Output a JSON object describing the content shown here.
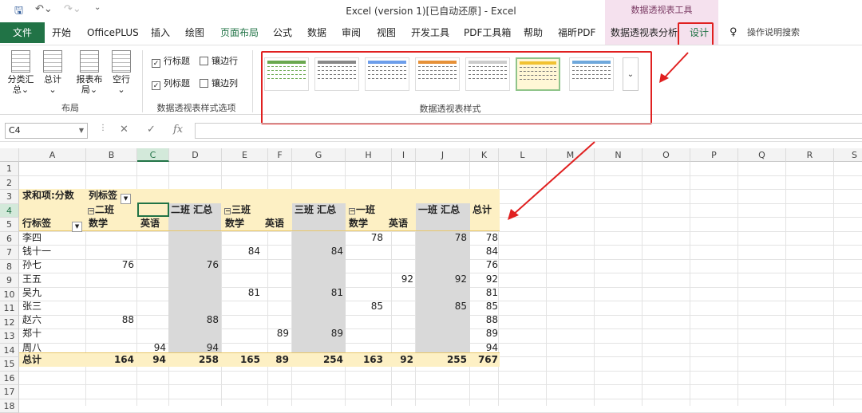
{
  "titlebar": {
    "title": "Excel (version 1)[已自动还原]  -  Excel",
    "context_tools": "数据透视表工具"
  },
  "tabs": [
    {
      "label": "文件"
    },
    {
      "label": "开始"
    },
    {
      "label": "OfficePLUS"
    },
    {
      "label": "插入"
    },
    {
      "label": "绘图"
    },
    {
      "label": "页面布局"
    },
    {
      "label": "公式"
    },
    {
      "label": "数据"
    },
    {
      "label": "审阅"
    },
    {
      "label": "视图"
    },
    {
      "label": "开发工具"
    },
    {
      "label": "PDF工具箱"
    },
    {
      "label": "帮助"
    },
    {
      "label": "福昕PDF"
    },
    {
      "label": "数据透视表分析"
    },
    {
      "label": "设计"
    },
    {
      "label": "操作说明搜索"
    }
  ],
  "ribbon": {
    "layout_buttons": [
      {
        "label1": "分类汇",
        "label2": "总⌄"
      },
      {
        "label1": "总计",
        "label2": "⌄"
      },
      {
        "label1": "报表布",
        "label2": "局⌄"
      },
      {
        "label1": "空行",
        "label2": "⌄"
      }
    ],
    "layout_group": "布局",
    "options": [
      {
        "label": "行标题",
        "checked": true
      },
      {
        "label": "镶边行",
        "checked": false
      },
      {
        "label": "列标题",
        "checked": true
      },
      {
        "label": "镶边列",
        "checked": false
      }
    ],
    "options_group": "数据透视表样式选项",
    "styles_group": "数据透视表样式"
  },
  "formula_bar": {
    "name_box": "C4",
    "fx": "fx"
  },
  "columns": [
    "A",
    "B",
    "C",
    "D",
    "E",
    "F",
    "G",
    "H",
    "I",
    "J",
    "K",
    "L",
    "M",
    "N",
    "O",
    "P",
    "Q",
    "R",
    "S"
  ],
  "rows": [
    "1",
    "2",
    "3",
    "4",
    "5",
    "6",
    "7",
    "8",
    "9",
    "10",
    "11",
    "12",
    "13",
    "14",
    "15",
    "16",
    "17",
    "18"
  ],
  "pivot": {
    "value_field": "求和项:分数",
    "col_labels": "列标签",
    "row_labels": "行标签",
    "class2": "二班",
    "class2_total": "二班 汇总",
    "class3": "三班",
    "class3_total": "三班 汇总",
    "class1": "一班",
    "class1_total": "一班 汇总",
    "grand_total": "总计",
    "math": "数学",
    "english": "英语",
    "data_rows": [
      {
        "name": "李四",
        "c2m": "",
        "c2e": "",
        "c2t": "",
        "c3m": "",
        "c3e": "",
        "c3t": "",
        "c1m": "78",
        "c1e": "",
        "c1t": "78",
        "total": "78"
      },
      {
        "name": "钱十一",
        "c2m": "",
        "c2e": "",
        "c2t": "",
        "c3m": "84",
        "c3e": "",
        "c3t": "84",
        "c1m": "",
        "c1e": "",
        "c1t": "",
        "total": "84"
      },
      {
        "name": "孙七",
        "c2m": "76",
        "c2e": "",
        "c2t": "76",
        "c3m": "",
        "c3e": "",
        "c3t": "",
        "c1m": "",
        "c1e": "",
        "c1t": "",
        "total": "76"
      },
      {
        "name": "王五",
        "c2m": "",
        "c2e": "",
        "c2t": "",
        "c3m": "",
        "c3e": "",
        "c3t": "",
        "c1m": "",
        "c1e": "92",
        "c1t": "92",
        "total": "92"
      },
      {
        "name": "吴九",
        "c2m": "",
        "c2e": "",
        "c2t": "",
        "c3m": "81",
        "c3e": "",
        "c3t": "81",
        "c1m": "",
        "c1e": "",
        "c1t": "",
        "total": "81"
      },
      {
        "name": "张三",
        "c2m": "",
        "c2e": "",
        "c2t": "",
        "c3m": "",
        "c3e": "",
        "c3t": "",
        "c1m": "85",
        "c1e": "",
        "c1t": "85",
        "total": "85"
      },
      {
        "name": "赵六",
        "c2m": "88",
        "c2e": "",
        "c2t": "88",
        "c3m": "",
        "c3e": "",
        "c3t": "",
        "c1m": "",
        "c1e": "",
        "c1t": "",
        "total": "88"
      },
      {
        "name": "郑十",
        "c2m": "",
        "c2e": "",
        "c2t": "",
        "c3m": "",
        "c3e": "89",
        "c3t": "89",
        "c1m": "",
        "c1e": "",
        "c1t": "",
        "total": "89"
      },
      {
        "name": "周八",
        "c2m": "",
        "c2e": "94",
        "c2t": "94",
        "c3m": "",
        "c3e": "",
        "c3t": "",
        "c1m": "",
        "c1e": "",
        "c1t": "",
        "total": "94"
      }
    ],
    "total_row": {
      "name": "总计",
      "c2m": "164",
      "c2e": "94",
      "c2t": "258",
      "c3m": "165",
      "c3e": "89",
      "c3t": "254",
      "c1m": "163",
      "c1e": "92",
      "c1t": "255",
      "total": "767"
    }
  },
  "colors": {
    "accent": "#217346",
    "highlight": "#e02020",
    "pivot_band": "#fdf0c4",
    "subtotal_col": "#d9d9d9"
  }
}
